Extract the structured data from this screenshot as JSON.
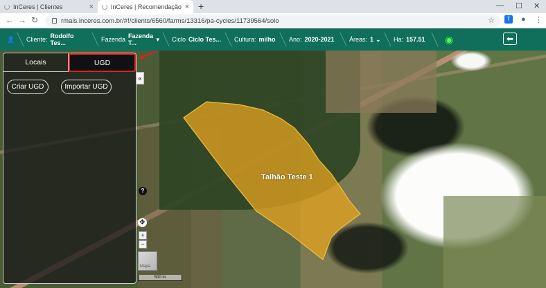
{
  "browser": {
    "tabs": [
      {
        "title": "InCeres | Clientes",
        "active": false
      },
      {
        "title": "InCeres | Recomendação",
        "active": true
      }
    ],
    "url": "rmais.inceres.com.br/#!/clients/6560/farms/13316/pa-cycles/11739564/solo",
    "new_tab_symbol": "+",
    "window_controls": {
      "minimize": "—",
      "maximize": "☐",
      "close": "✕"
    }
  },
  "header": {
    "cliente_label": "Cliente:",
    "cliente_value": "Rodolfo Tes...",
    "fazenda_label": "Fazenda",
    "fazenda_value": "Fazenda T...",
    "ciclo_label": "Ciclo",
    "ciclo_value": "Ciclo Tes...",
    "cultura_label": "Cultura:",
    "cultura_value": "milho",
    "ano_label": "Ano:",
    "ano_value": "2020-2021",
    "areas_label": "Áreas:",
    "areas_value": "1",
    "ha_label": "Ha:",
    "ha_value": "157.51",
    "accent_color": "#0f6f5a"
  },
  "panel": {
    "tabs": [
      {
        "label": "Locais",
        "active": false
      },
      {
        "label": "UGD",
        "active": true
      }
    ],
    "buttons": {
      "criar": "Criar UGD",
      "importar": "Importar UGD"
    },
    "highlight_color": "#e02020"
  },
  "map": {
    "plot_label": "Talhão Teste 1",
    "plot_color": "#e0a020",
    "scale_label": "500 m",
    "thumbnail_label": "Mapa",
    "help_symbol": "?",
    "zoom_in": "+",
    "zoom_out": "−",
    "collapse_symbol": "«"
  }
}
